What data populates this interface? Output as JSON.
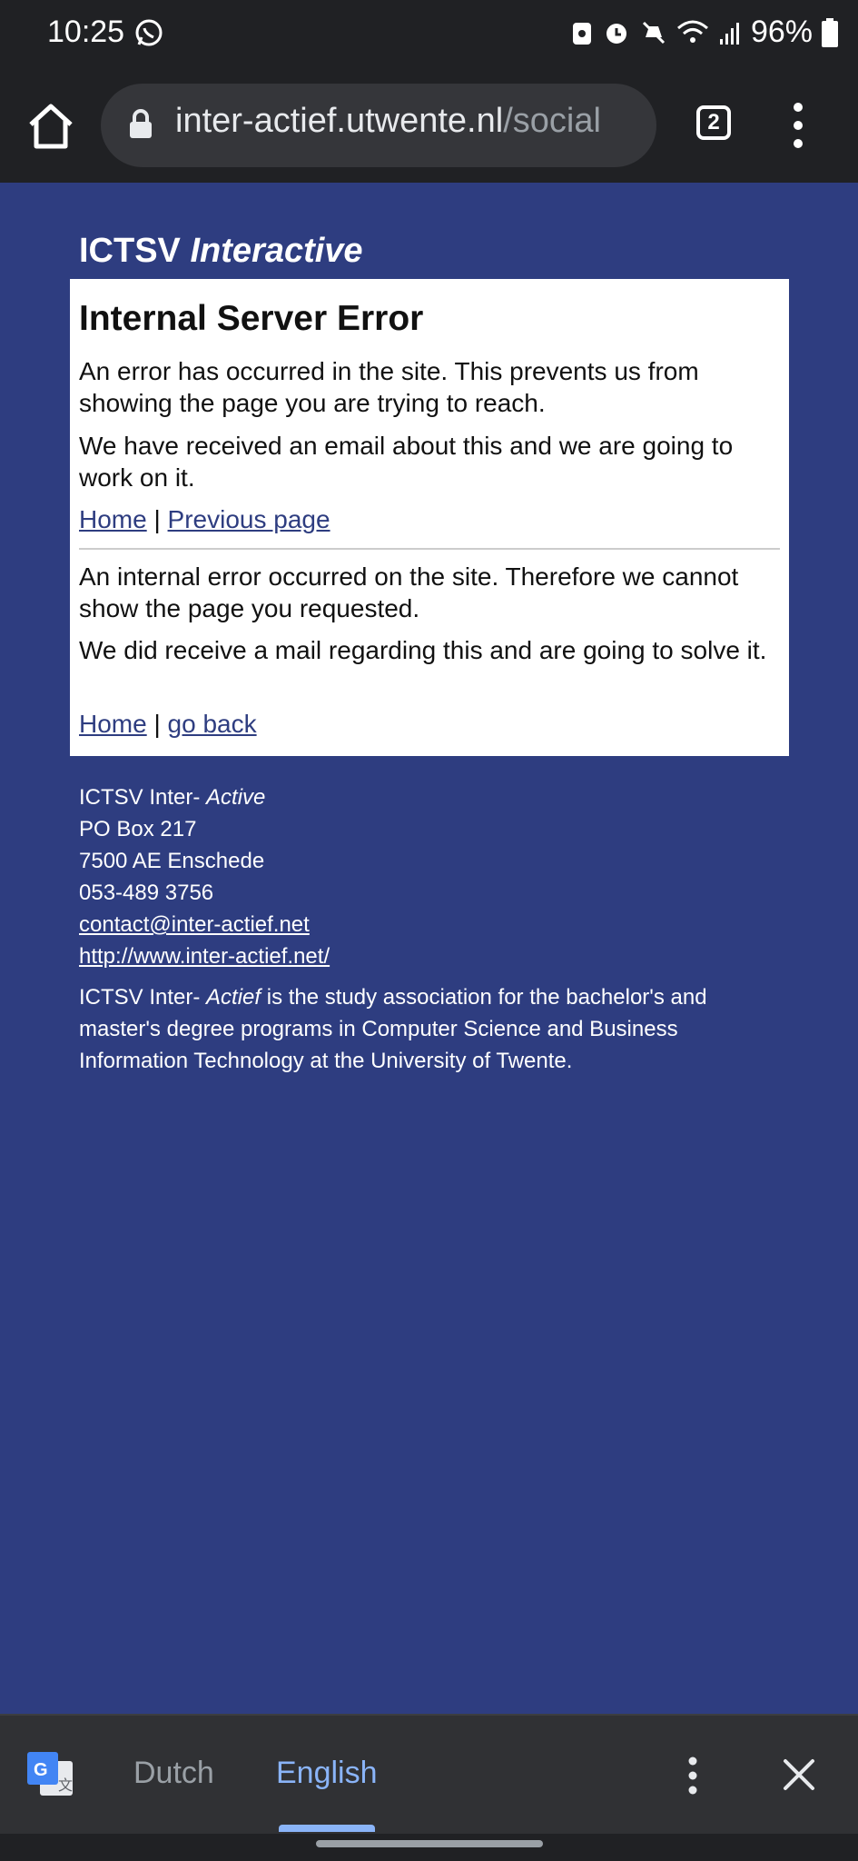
{
  "status_bar": {
    "time": "10:25",
    "battery": "96%"
  },
  "browser": {
    "url_host": "inter-actief.utwente.nl",
    "url_path": "/social",
    "tab_count": "2"
  },
  "site": {
    "title_plain": "ICTSV",
    "title_italic": "Interactive"
  },
  "error": {
    "heading": "Internal Server Error",
    "para1": "An error has occurred in the site. This prevents us from showing the page you are trying to reach.",
    "para2": "We have received an email about this and we are going to work on it.",
    "link_home_1": "Home",
    "separator_1": "|",
    "link_previous": "Previous page",
    "para3": "An internal error occurred on the site. Therefore we cannot show the page you requested.",
    "para4": "We did receive a mail regarding this and are going to solve it.",
    "link_home_2": "Home",
    "separator_2": "|",
    "link_back": "go back"
  },
  "footer": {
    "org_plain": "ICTSV Inter-",
    "org_italic": "Active",
    "po_box": "PO Box 217",
    "city": "7500 AE Enschede",
    "phone": "053-489 3756",
    "email": "contact@inter-actief.net",
    "website": "http://www.inter-actief.net/",
    "about_plain_1": "ICTSV Inter-",
    "about_italic": "Actief",
    "about_plain_2": " is the study association for the bachelor's and master's degree programs in Computer Science and Business Information Technology at the University of Twente."
  },
  "translate": {
    "source_lang": "Dutch",
    "target_lang": "English",
    "accent_color": "#8ab4f8"
  },
  "colors": {
    "page_background": "#2e3d80",
    "browser_chrome": "#202124"
  }
}
